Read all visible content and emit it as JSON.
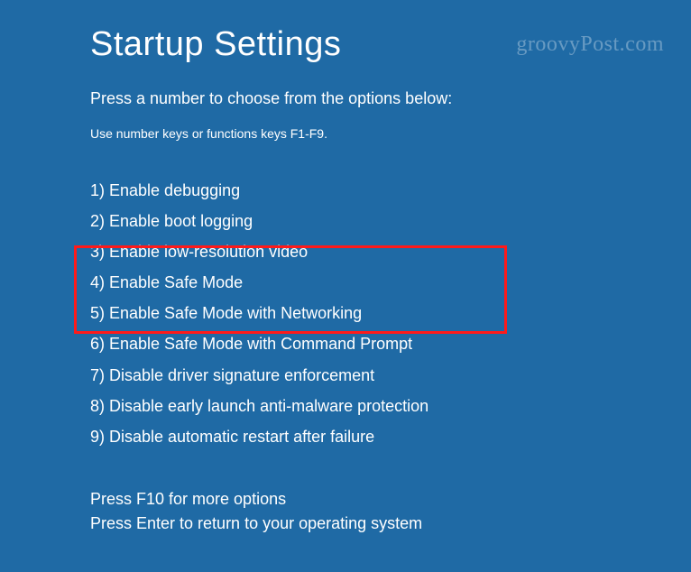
{
  "title": "Startup Settings",
  "subtitle": "Press a number to choose from the options below:",
  "hint": "Use number keys or functions keys F1-F9.",
  "options": [
    "1) Enable debugging",
    "2) Enable boot logging",
    "3) Enable low-resolution video",
    "4) Enable Safe Mode",
    "5) Enable Safe Mode with Networking",
    "6) Enable Safe Mode with Command Prompt",
    "7) Disable driver signature enforcement",
    "8) Disable early launch anti-malware protection",
    "9) Disable automatic restart after failure"
  ],
  "footer": {
    "more": "Press F10 for more options",
    "return": "Press Enter to return to your operating system"
  },
  "watermark": "groovyPost.com"
}
